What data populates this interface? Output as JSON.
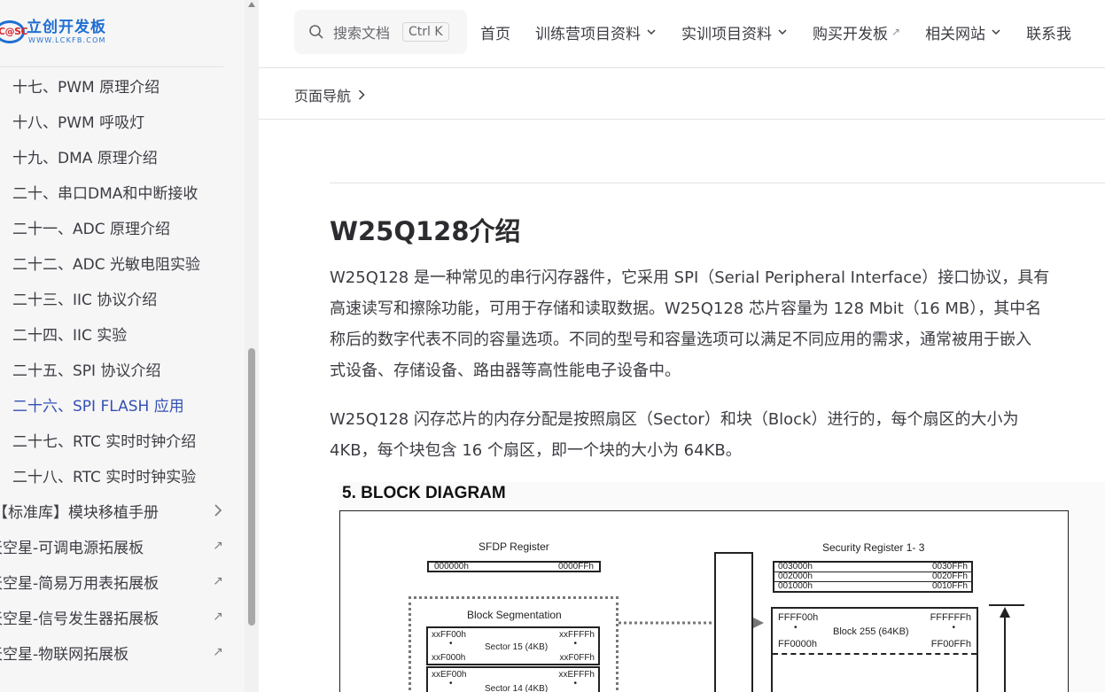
{
  "logo": {
    "mark_text": "C@SC",
    "name": "立创开发板",
    "url_text": "WWW.LCKFB.COM"
  },
  "sidebar": {
    "items": [
      {
        "label": "十七、PWM 原理介绍",
        "kind": "sub"
      },
      {
        "label": "十八、PWM 呼吸灯",
        "kind": "sub"
      },
      {
        "label": "十九、DMA 原理介绍",
        "kind": "sub"
      },
      {
        "label": "二十、串口DMA和中断接收",
        "kind": "sub"
      },
      {
        "label": "二十一、ADC 原理介绍",
        "kind": "sub"
      },
      {
        "label": "二十二、ADC 光敏电阻实验",
        "kind": "sub"
      },
      {
        "label": "二十三、IIC 协议介绍",
        "kind": "sub"
      },
      {
        "label": "二十四、IIC 实验",
        "kind": "sub"
      },
      {
        "label": "二十五、SPI 协议介绍",
        "kind": "sub"
      },
      {
        "label": "二十六、SPI FLASH 应用",
        "kind": "sub-active"
      },
      {
        "label": "二十七、RTC 实时时钟介绍",
        "kind": "sub"
      },
      {
        "label": "二十八、RTC 实时时钟实验",
        "kind": "sub"
      },
      {
        "label": "【标准库】模块移植手册",
        "kind": "group"
      },
      {
        "label": "天空星-可调电源拓展板",
        "kind": "external",
        "icon": "↗"
      },
      {
        "label": "天空星-简易万用表拓展板",
        "kind": "external",
        "icon": "↗"
      },
      {
        "label": "天空星-信号发生器拓展板",
        "kind": "external",
        "icon": "↗"
      },
      {
        "label": "天空星-物联网拓展板",
        "kind": "external",
        "icon": "↗"
      }
    ]
  },
  "search": {
    "placeholder": "搜索文档",
    "shortcut": "Ctrl K"
  },
  "topnav": {
    "items": [
      {
        "label": "首页",
        "type": "link"
      },
      {
        "label": "训练营项目资料",
        "type": "dropdown"
      },
      {
        "label": "实训项目资料",
        "type": "dropdown"
      },
      {
        "label": "购买开发板",
        "type": "external",
        "icon": "↗"
      },
      {
        "label": "相关网站",
        "type": "dropdown"
      },
      {
        "label": "联系我",
        "type": "link"
      }
    ]
  },
  "pagenav": {
    "label": "页面导航"
  },
  "article": {
    "heading": "W25Q128介绍",
    "para1_lines": [
      "W25Q128 是一种常见的串行闪存器件，它采用 SPI（Serial Peripheral Interface）接口协议，具有",
      "高速读写和擦除功能，可用于存储和读取数据。W25Q128 芯片容量为 128 Mbit（16 MB），其中名",
      "称后的数字代表不同的容量选项。不同的型号和容量选项可以满足不同应用的需求，通常被用于嵌入",
      "式设备、存储设备、路由器等高性能电子设备中。"
    ],
    "para2_lines": [
      "W25Q128 闪存芯片的内存分配是按照扇区（Sector）和块（Block）进行的，每个扇区的大小为",
      "4KB，每个块包含 16 个扇区，即一个块的大小为 64KB。"
    ]
  },
  "diagram": {
    "title": "5.  BLOCK DIAGRAM",
    "sfdp_label": "SFDP Register",
    "sfdp_start": "000000h",
    "sfdp_end": "0000FFh",
    "security_label": "Security Register 1- 3",
    "security_rows": [
      {
        "start": "003000h",
        "end": "0030FFh"
      },
      {
        "start": "002000h",
        "end": "0020FFh"
      },
      {
        "start": "001000h",
        "end": "0010FFh"
      }
    ],
    "block_seg_label": "Block Segmentation",
    "sector15": {
      "top_left": "xxFF00h",
      "top_right": "xxFFFFh",
      "name": "Sector 15 (4KB)",
      "bot_left": "xxF000h",
      "bot_right": "xxF0FFh"
    },
    "sector14": {
      "top_left": "xxEF00h",
      "top_right": "xxEFFFh",
      "name": "Sector 14 (4KB)"
    },
    "block255": {
      "top_left": "FFFF00h",
      "top_right": "FFFFFFh",
      "name": "Block 255 (64KB)",
      "bot_left": "FF0000h",
      "bot_right": "FF00FFh"
    },
    "dot": "•"
  }
}
